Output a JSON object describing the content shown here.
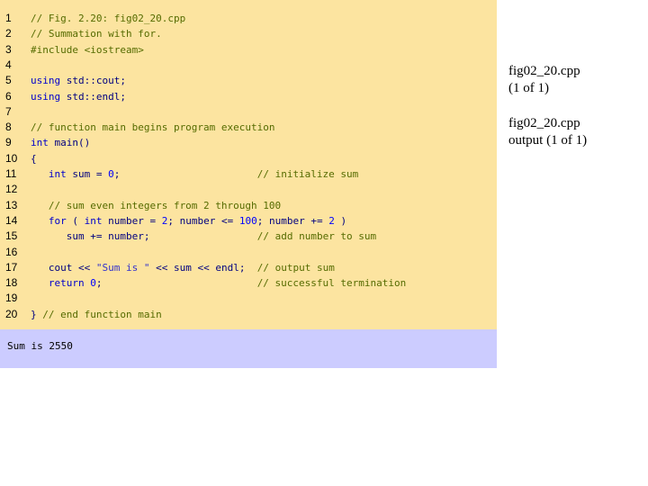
{
  "code": {
    "lines": [
      {
        "n": "1",
        "text": "// Fig. 2.20: fig02_20.cpp"
      },
      {
        "n": "2",
        "text": "// Summation with for."
      },
      {
        "n": "3",
        "text": "#include <iostream>"
      },
      {
        "n": "4",
        "text": ""
      },
      {
        "n": "5",
        "text": "using std::cout;"
      },
      {
        "n": "6",
        "text": "using std::endl;"
      },
      {
        "n": "7",
        "text": ""
      },
      {
        "n": "8",
        "text": "// function main begins program execution"
      },
      {
        "n": "9",
        "text": "int main()"
      },
      {
        "n": "10",
        "text": "{"
      },
      {
        "n": "11",
        "text": "   int sum = 0;                       // initialize sum"
      },
      {
        "n": "12",
        "text": ""
      },
      {
        "n": "13",
        "text": "   // sum even integers from 2 through 100"
      },
      {
        "n": "14",
        "text": "   for ( int number = 2; number <= 100; number += 2 )"
      },
      {
        "n": "15",
        "text": "      sum += number;                  // add number to sum"
      },
      {
        "n": "16",
        "text": ""
      },
      {
        "n": "17",
        "text": "   cout << \"Sum is \" << sum << endl;  // output sum"
      },
      {
        "n": "18",
        "text": "   return 0;                          // successful termination"
      },
      {
        "n": "19",
        "text": ""
      },
      {
        "n": "20",
        "text": "} // end function main"
      }
    ]
  },
  "output": {
    "text": "Sum is 2550"
  },
  "side": {
    "file_label": "fig02_20.cpp",
    "file_page": "(1 of 1)",
    "output_label": "fig02_20.cpp",
    "output_page": "output (1 of 1)"
  },
  "colors": {
    "code_background": "#fce4a0",
    "output_background": "#ccccff"
  }
}
